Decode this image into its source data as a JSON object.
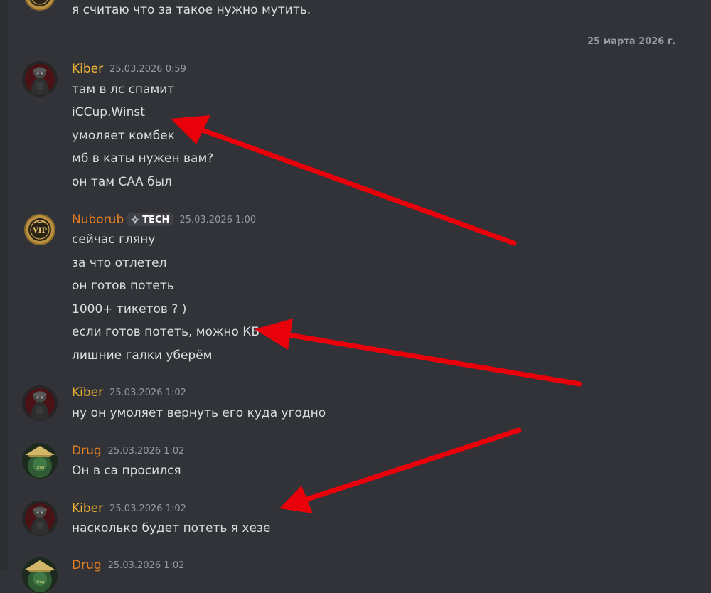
{
  "colors": {
    "background": "#313338",
    "text": "#dbdee1",
    "timestamp": "#949ba4",
    "author_yellow": "#f0b232",
    "author_orange": "#e67e22",
    "arrow": "#e8000b"
  },
  "top": {
    "text": "я считаю что за такое нужно мутить."
  },
  "divider": {
    "date": "25 марта 2026 г."
  },
  "messages": [
    {
      "author": "Kiber",
      "timestamp": "25.03.2026 0:59",
      "lines": [
        "там в лс спамит",
        "iCCup.Winst",
        "умоляет комбек",
        "мб в каты нужен вам?",
        "он там САА был"
      ]
    },
    {
      "author": "Nuborub",
      "tag": "TECH",
      "timestamp": "25.03.2026 1:00",
      "lines": [
        "сейчас гляну",
        "за что отлетел",
        "он готов потеть",
        "1000+ тикетов ? )",
        "если готов потеть, можно КБ",
        "лишние галки уберём"
      ]
    },
    {
      "author": "Kiber",
      "timestamp": "25.03.2026 1:02",
      "lines": [
        "ну он умоляет вернуть его куда угодно"
      ]
    },
    {
      "author": "Drug",
      "timestamp": "25.03.2026 1:02",
      "lines": [
        "Он в са просился"
      ]
    },
    {
      "author": "Kiber",
      "timestamp": "25.03.2026 1:02",
      "lines": [
        "насколько будет потеть я хезе"
      ]
    },
    {
      "author": "Drug",
      "timestamp": "25.03.2026 1:02",
      "lines": []
    }
  ]
}
